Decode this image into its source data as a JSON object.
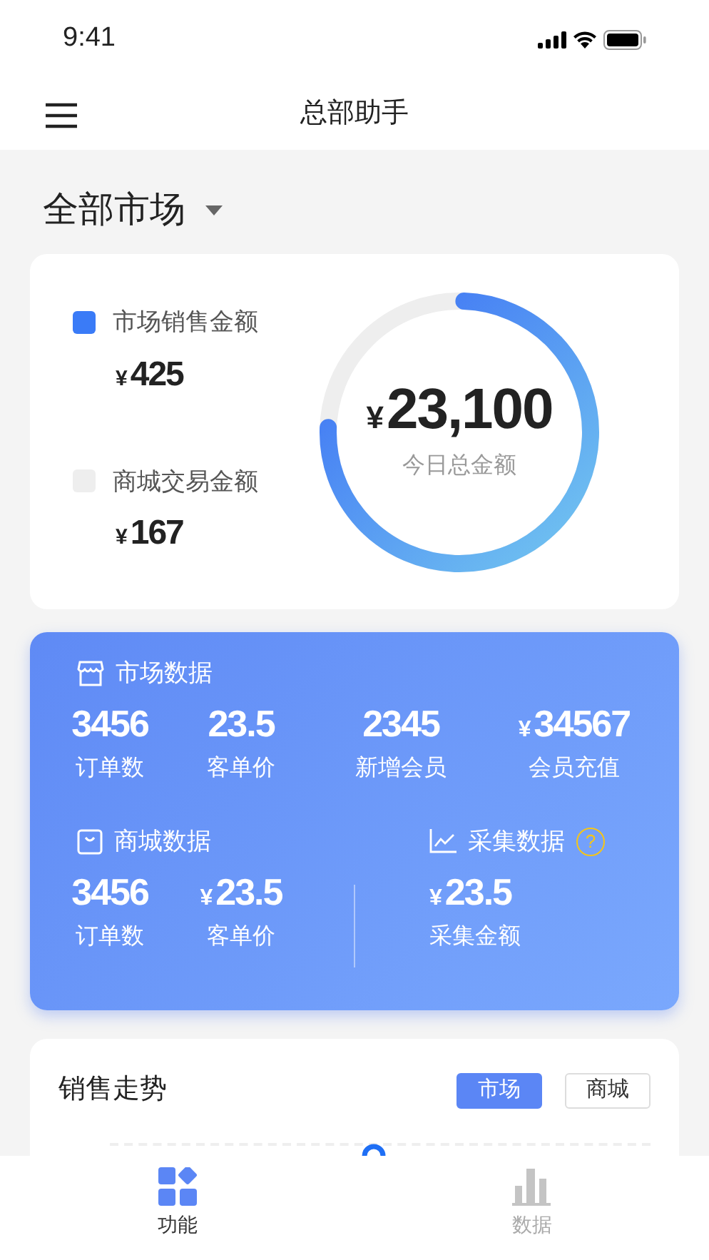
{
  "status_bar": {
    "time": "9:41"
  },
  "header": {
    "title": "总部助手"
  },
  "market_selector": {
    "label": "全部市场"
  },
  "summary": {
    "legend": [
      {
        "label": "市场销售金额",
        "currency": "¥",
        "amount": "425",
        "color": "#3a7bf7"
      },
      {
        "label": "商城交易金额",
        "currency": "¥",
        "amount": "167",
        "color": "#eeeeee"
      }
    ],
    "ring": {
      "currency": "¥",
      "total": "23,100",
      "caption": "今日总金额",
      "level": 0.75
    }
  },
  "market_data": {
    "title": "市场数据",
    "stats": [
      {
        "value": "3456",
        "label": "订单数"
      },
      {
        "value": "23.5",
        "label": "客单价"
      },
      {
        "value": "2345",
        "label": "新增会员"
      },
      {
        "currency": "¥",
        "value": "34567",
        "label": "会员充值"
      }
    ]
  },
  "mall_data": {
    "title": "商城数据",
    "stats": [
      {
        "value": "3456",
        "label": "订单数"
      },
      {
        "currency": "¥",
        "value": "23.5",
        "label": "客单价"
      }
    ]
  },
  "collect_data": {
    "title": "采集数据",
    "help": "?",
    "stats": [
      {
        "currency": "¥",
        "value": "23.5",
        "label": "采集金额"
      }
    ]
  },
  "trend": {
    "title": "销售走势",
    "toggles": [
      {
        "label": "市场",
        "selected": true
      },
      {
        "label": "商城",
        "selected": false
      }
    ]
  },
  "tab_bar": [
    {
      "kind": "grid",
      "label": "功能",
      "selected": true
    },
    {
      "kind": "bars",
      "label": "数据",
      "selected": false
    }
  ]
}
